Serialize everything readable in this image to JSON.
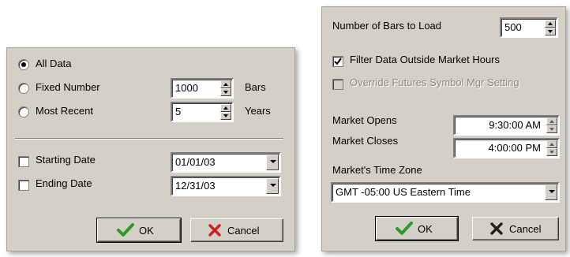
{
  "left_dialog": {
    "radios": [
      {
        "label": "All Data",
        "selected": true
      },
      {
        "label": "Fixed Number",
        "selected": false
      },
      {
        "label": "Most Recent",
        "selected": false
      }
    ],
    "fixed_number": {
      "value": "1000",
      "unit": "Bars"
    },
    "most_recent": {
      "value": "5",
      "unit": "Years"
    },
    "starting_date": {
      "label": "Starting Date",
      "checked": false,
      "value": "01/01/03"
    },
    "ending_date": {
      "label": "Ending Date",
      "checked": false,
      "value": "12/31/03"
    },
    "ok_label": "OK",
    "cancel_label": "Cancel"
  },
  "right_dialog": {
    "bars_to_load": {
      "label": "Number of Bars to Load",
      "value": "500"
    },
    "filter_data": {
      "label": "Filter Data Outside Market Hours",
      "checked": true
    },
    "override_futures": {
      "label": "Override Futures Symbol Mgr Setting",
      "checked": false,
      "enabled": false
    },
    "market_opens": {
      "label": "Market Opens",
      "value": "9:30:00 AM"
    },
    "market_closes": {
      "label": "Market Closes",
      "value": "4:00:00 PM"
    },
    "time_zone": {
      "label": "Market's Time Zone",
      "value": "GMT -05:00  US Eastern Time"
    },
    "ok_label": "OK",
    "cancel_label": "Cancel"
  },
  "colors": {
    "dialog_bg": "#d4d0c8",
    "ok_check": "#2e9a2e",
    "cancel_x": "#cc1f1f"
  },
  "icons": {
    "ok": "check-icon",
    "cancel": "x-icon"
  }
}
